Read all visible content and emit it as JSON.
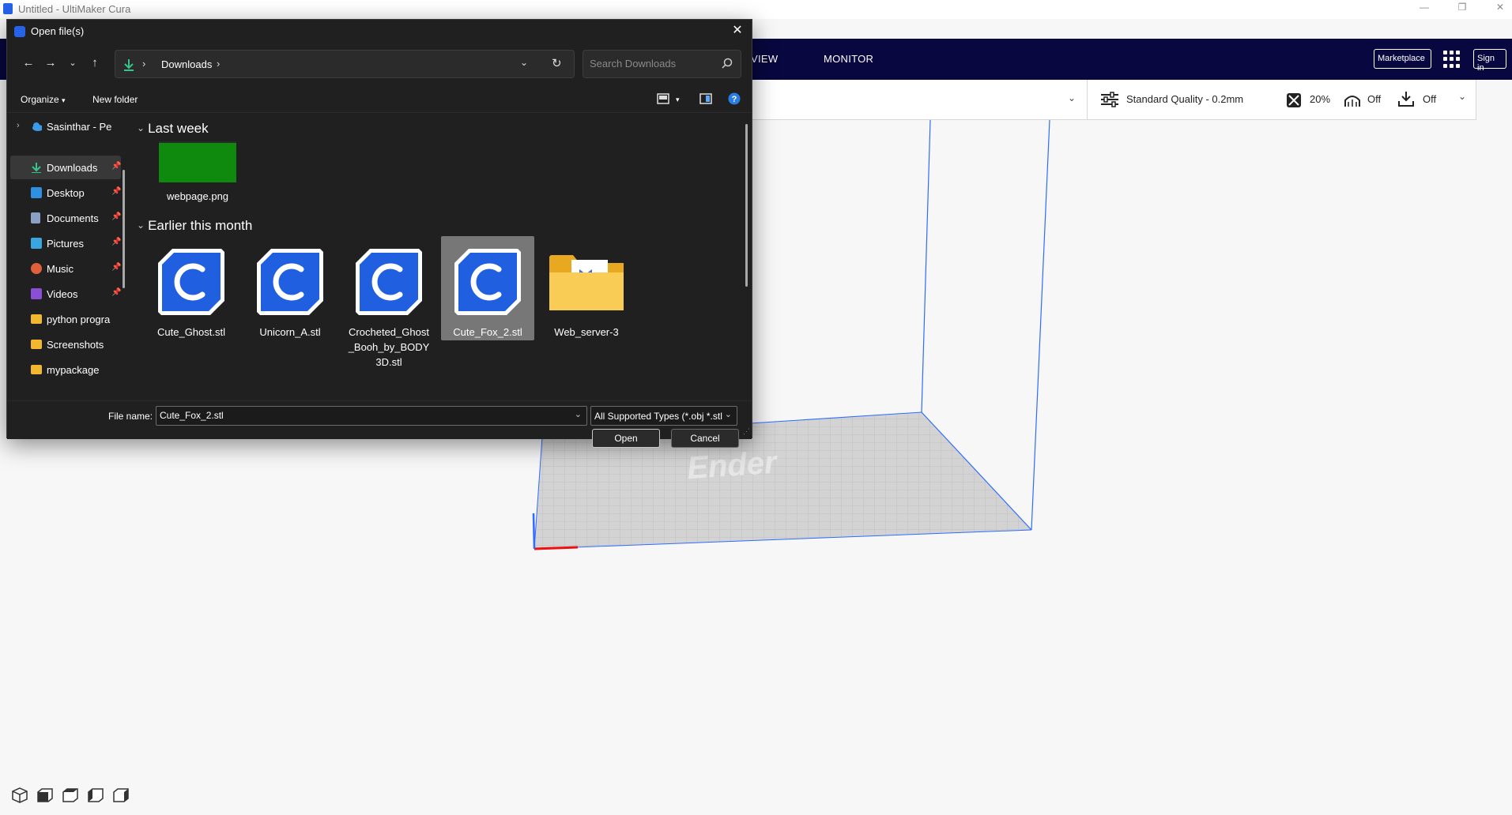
{
  "app": {
    "window_title": "Untitled - UltiMaker Cura"
  },
  "cura_header": {
    "tabs": [
      "VIEW",
      "MONITOR"
    ],
    "marketplace_label": "Marketplace",
    "signin_label": "Sign in"
  },
  "print_settings": {
    "profile": "Standard Quality - 0.2mm",
    "infill": "20%",
    "support": "Off",
    "adhesion": "Off"
  },
  "dialog": {
    "title": "Open file(s)",
    "address": {
      "crumb": "Downloads"
    },
    "search": {
      "placeholder": "Search Downloads"
    },
    "toolbar": {
      "organize": "Organize",
      "new_folder": "New folder"
    },
    "nav": [
      {
        "label": "Sasinthar - Pe",
        "icon": "onedrive-icon",
        "pinned": false
      },
      {
        "label": "Downloads",
        "icon": "downloads-icon",
        "pinned": true
      },
      {
        "label": "Desktop",
        "icon": "desktop-icon",
        "pinned": true
      },
      {
        "label": "Documents",
        "icon": "documents-icon",
        "pinned": true
      },
      {
        "label": "Pictures",
        "icon": "pictures-icon",
        "pinned": true
      },
      {
        "label": "Music",
        "icon": "music-icon",
        "pinned": true
      },
      {
        "label": "Videos",
        "icon": "videos-icon",
        "pinned": true
      },
      {
        "label": "python progra",
        "icon": "folder-icon",
        "pinned": false
      },
      {
        "label": "Screenshots",
        "icon": "folder-icon",
        "pinned": false
      },
      {
        "label": "mypackage",
        "icon": "folder-icon",
        "pinned": false
      }
    ],
    "groups": [
      {
        "header": "Last week",
        "files": [
          {
            "name": "webpage.png",
            "type": "image"
          }
        ]
      },
      {
        "header": "Earlier this month",
        "files": [
          {
            "name": "Cute_Ghost.stl",
            "type": "cura"
          },
          {
            "name": "Unicorn_A.stl",
            "type": "cura"
          },
          {
            "name": "Crocheted_Ghost_Booh_by_BODY3D.stl",
            "type": "cura",
            "lines": [
              "Crocheted_Ghost",
              "_Booh_by_BODY",
              "3D.stl"
            ]
          },
          {
            "name": "Cute_Fox_2.stl",
            "type": "cura",
            "selected": true
          },
          {
            "name": "Web_server-3",
            "type": "folder"
          }
        ]
      }
    ],
    "file_name_label": "File name:",
    "file_name_value": "Cute_Fox_2.stl",
    "file_type": "All Supported Types (*.obj *.stl *",
    "open_label": "Open",
    "cancel_label": "Cancel"
  },
  "colors": {
    "cura_navy": "#08073f",
    "dialog_bg": "#202020",
    "cura_blue": "#1f5fe0",
    "build_plate": "#cfcfcf"
  }
}
